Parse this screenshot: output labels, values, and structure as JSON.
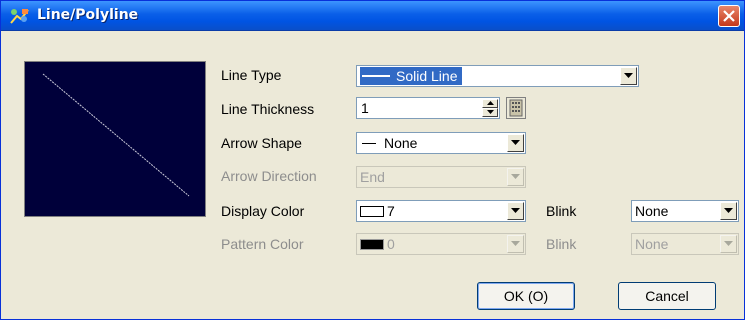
{
  "window": {
    "title": "Line/Polyline"
  },
  "fields": {
    "line_type": {
      "label": "Line Type",
      "value": "Solid Line"
    },
    "line_thickness": {
      "label": "Line Thickness",
      "value": "1"
    },
    "arrow_shape": {
      "label": "Arrow Shape",
      "value": "None"
    },
    "arrow_direction": {
      "label": "Arrow Direction",
      "value": "End"
    },
    "display_color": {
      "label": "Display Color",
      "value": "7",
      "blink_label": "Blink",
      "blink_value": "None"
    },
    "pattern_color": {
      "label": "Pattern Color",
      "value": "0",
      "blink_label": "Blink",
      "blink_value": "None"
    }
  },
  "buttons": {
    "ok": "OK (O)",
    "cancel": "Cancel"
  },
  "colors": {
    "titlebar": "#0054E3",
    "preview_bg": "#00003A",
    "selection": "#316AC5",
    "dialog_bg": "#ECE9D8"
  },
  "icons": {
    "title": "line-tool-icon",
    "close": "close-icon",
    "keypad": "keypad-icon"
  }
}
